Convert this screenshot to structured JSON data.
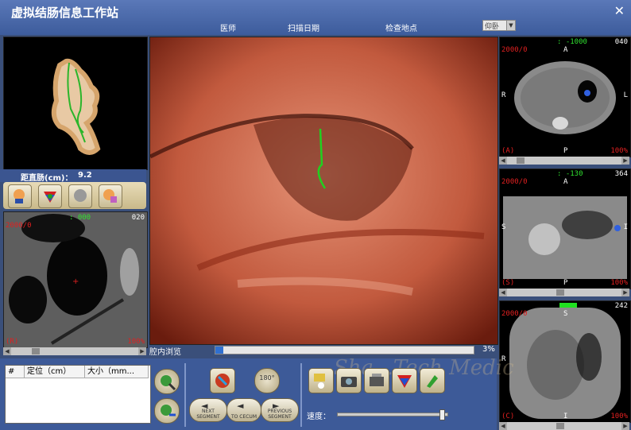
{
  "window": {
    "title": "虚拟结肠信息工作站",
    "close_label": "✕"
  },
  "header": {
    "doctor": "医师",
    "scan_date": "扫描日期",
    "location": "检查地点",
    "position_value": "仰卧"
  },
  "overview": {
    "distance_label": "距直肠(cm)：",
    "distance_value": "9.2"
  },
  "slice_top_left": {
    "top_value": ": 000",
    "slice_no": "020",
    "window": "2000/0",
    "orient": "(R)",
    "zoom": "100%"
  },
  "axial": {
    "level": ": -1000",
    "slice_no": "040",
    "window": "2000/0",
    "top": "A",
    "left": "R",
    "right": "L",
    "bottom": "P",
    "orient": "(A)",
    "zoom": "100%"
  },
  "sagittal": {
    "level": ": -130",
    "slice_no": "364",
    "window": "2000/0",
    "top": "A",
    "left": "S",
    "right": "I",
    "bottom": "P",
    "orient": "(S)",
    "zoom": "100%"
  },
  "coronal": {
    "slice_no": "242",
    "window": "2000/0",
    "top": "S",
    "left": "R",
    "bottom": "I",
    "orient": "(C)",
    "zoom": "100%"
  },
  "endoscopy": {
    "label": "腔内浏览",
    "progress_percent": 3,
    "progress_text": "3%"
  },
  "table": {
    "columns": [
      "#",
      "定位（cm）",
      "大小（mm..."
    ]
  },
  "nav": {
    "next": "NEXT SEGMENT",
    "cecum": "TO CECUM",
    "previous": "PREVIOUS SEGMENT",
    "rotate": "180°"
  },
  "speed": {
    "label": "速度：",
    "value_fraction": 0.97
  },
  "watermark": "Sha...Tech Medic"
}
